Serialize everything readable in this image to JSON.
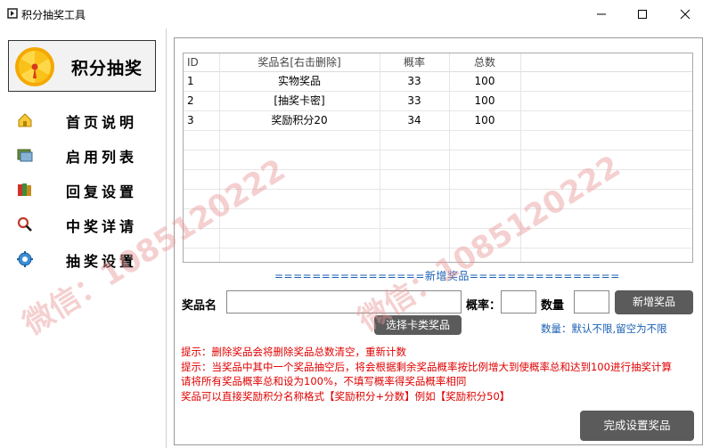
{
  "window": {
    "title": "积分抽奖工具"
  },
  "sidebar": {
    "brand_title": "积分抽奖",
    "items": [
      {
        "label": "首页说明",
        "icon": "home-icon"
      },
      {
        "label": "启用列表",
        "icon": "list-icon"
      },
      {
        "label": "回复设置",
        "icon": "books-icon"
      },
      {
        "label": "中奖详请",
        "icon": "search-icon"
      },
      {
        "label": "抽奖设置",
        "icon": "gear-icon"
      }
    ]
  },
  "table": {
    "headers": {
      "id": "ID",
      "name": "奖品名[右击删除]",
      "prob": "概率",
      "total": "总数"
    },
    "rows": [
      {
        "id": "1",
        "name": "实物奖品",
        "prob": "33",
        "total": "100"
      },
      {
        "id": "2",
        "name": "[抽奖卡密]",
        "prob": "33",
        "total": "100"
      },
      {
        "id": "3",
        "name": "奖励积分20",
        "prob": "34",
        "total": "100"
      }
    ]
  },
  "form": {
    "section_title": "================新增奖品================",
    "name_label": "奖品名",
    "name_value": "",
    "prob_label": "概率：",
    "prob_value": "",
    "qty_label": "数量",
    "qty_value": "",
    "add_button": "新增奖品",
    "choose_button": "选择卡类奖品",
    "qty_hint": "数量：默认不限,留空为不限"
  },
  "notes": [
    "提示：删除奖品会将删除奖品总数清空，重新计数",
    "提示：当奖品中其中一个奖品抽空后，将会根据剩余奖品概率按比例增大到使概率总和达到100进行抽奖计算",
    "请将所有奖品概率总和设为100%，不填写概率得奖品概率相同",
    "奖品可以直接奖励积分名称格式【奖励积分+分数】例如【奖励积分50】"
  ],
  "finish_button": "完成设置奖品",
  "watermarks": [
    "微信：1085120222",
    "微信：1085120222"
  ]
}
